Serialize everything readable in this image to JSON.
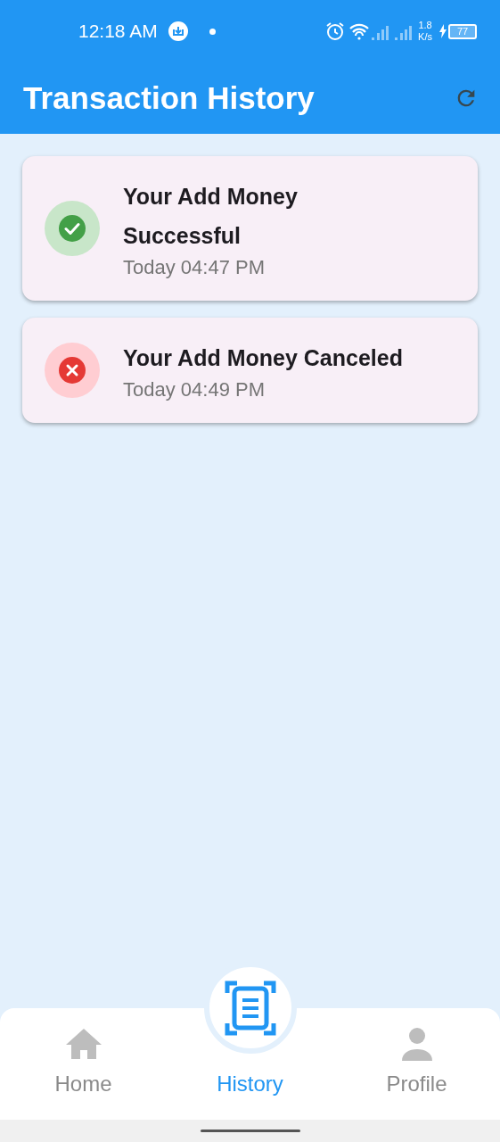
{
  "status_bar": {
    "time": "12:18 AM",
    "net_speed_value": "1.8",
    "net_speed_unit": "K/s",
    "battery": "77"
  },
  "app_bar": {
    "title": "Transaction History"
  },
  "transactions": [
    {
      "kind": "success",
      "title": "Your Add Money\nSuccessful",
      "time": "Today 04:47 PM"
    },
    {
      "kind": "failed",
      "title": "Your Add Money Canceled",
      "time": "Today 04:49 PM"
    }
  ],
  "bottom_nav": [
    {
      "kind": "home",
      "label": "Home",
      "selected": false
    },
    {
      "kind": "history",
      "label": "History",
      "selected": true
    },
    {
      "kind": "profile",
      "label": "Profile",
      "selected": false
    }
  ]
}
